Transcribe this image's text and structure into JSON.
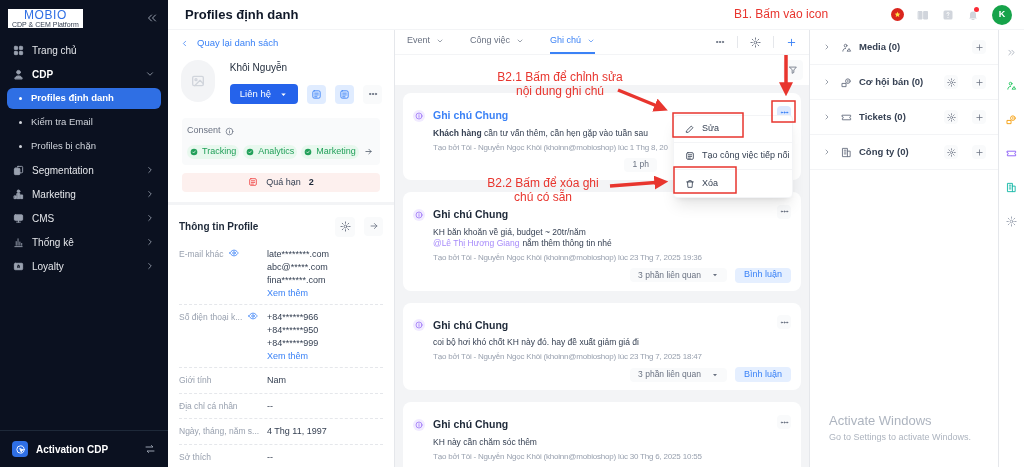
{
  "sidebar": {
    "logo": {
      "title": "MOBIO",
      "subtitle": "CDP & CEM Platform"
    },
    "items": [
      {
        "label": "Trang chủ",
        "kind": "home",
        "selected": false
      },
      {
        "label": "CDP",
        "kind": "person",
        "selected": false,
        "expanded": true,
        "children": [
          {
            "label": "Profiles định danh",
            "selected": true
          },
          {
            "label": "Kiểm tra Email",
            "selected": false
          },
          {
            "label": "Profiles bị chặn",
            "selected": false
          }
        ]
      },
      {
        "label": "Segmentation",
        "kind": "segment",
        "selected": false,
        "expanded": false
      },
      {
        "label": "Marketing",
        "kind": "marketing",
        "selected": false,
        "expanded": false
      },
      {
        "label": "CMS",
        "kind": "monitor",
        "selected": false,
        "expanded": false
      },
      {
        "label": "Thống kê",
        "kind": "chart",
        "selected": false,
        "expanded": false
      },
      {
        "label": "Loyalty",
        "kind": "loyalty",
        "selected": false,
        "expanded": false
      }
    ],
    "footer": {
      "label": "Activation CDP"
    }
  },
  "header": {
    "title": "Profiles định danh",
    "notification_dot": true,
    "avatar": "K"
  },
  "profile": {
    "back": "Quay lại danh sách",
    "name": "Khôi Nguyễn",
    "contact_button": "Liên hệ",
    "consent": {
      "label": "Consent",
      "chips": [
        "Tracking",
        "Analytics",
        "Marketing"
      ]
    },
    "overdue": {
      "label": "Quá hạn",
      "count": "2"
    },
    "info_title": "Thông tin Profile",
    "fields": [
      {
        "label": "E-mail khác",
        "reveal_icon": true,
        "values": [
          "late********.com",
          "abc@*****.com",
          "fina*******.com"
        ],
        "more": "Xem thêm"
      },
      {
        "label": "Số điện thoại k...",
        "reveal_icon": true,
        "values": [
          "+84******966",
          "+84******950",
          "+84******999"
        ],
        "more": "Xem thêm"
      },
      {
        "label": "Giới tính",
        "values": [
          "Nam"
        ]
      },
      {
        "label": "Địa chỉ cá nhân",
        "values": [
          "--"
        ]
      },
      {
        "label": "Ngày, tháng, năm s...",
        "values": [
          "4 Thg 11, 1997"
        ]
      },
      {
        "label": "Sở thích",
        "values": [
          "--"
        ]
      }
    ]
  },
  "notes_panel": {
    "tabs": [
      {
        "label": "Event",
        "selected": false
      },
      {
        "label": "Công việc",
        "selected": false
      },
      {
        "label": "Ghi chú",
        "selected": true
      }
    ],
    "notes": [
      {
        "title": "Ghi chú Chung",
        "highlighted": true,
        "menu_open": true,
        "lines": [
          {
            "text": "**Khách hàng** cần tư vấn thêm, cần hẹn gặp vào tuần sau"
          }
        ],
        "meta": "Tạo bởi Tôi - Nguyễn Ngọc Khôi (khoinn@mobioshop) lúc 1 Thg 8, 20",
        "related": "1 ph"
      },
      {
        "title": "Ghi chú Chung",
        "highlighted": false,
        "menu_open": false,
        "lines": [
          {
            "text": "KH băn khoăn về giá, budget ~ 20tr/năm"
          },
          {
            "mention": "@Lê Thị Hương Giang",
            "text": "nắm thêm thông tin nhé"
          }
        ],
        "meta": "Tạo bởi Tôi - Nguyễn Ngọc Khôi (khoinn@mobioshop) lúc 23 Thg 7, 2025 19:36",
        "related": "3 phần liên quan",
        "comment": "Bình luận"
      },
      {
        "title": "Ghi chú Chung",
        "highlighted": false,
        "menu_open": false,
        "lines": [
          {
            "text": "coi bộ hơi khó chốt KH này đó. hay đề xuất giảm giá đi"
          }
        ],
        "meta": "Tạo bởi Tôi - Nguyễn Ngọc Khôi (khoinn@mobioshop) lúc 23 Thg 7, 2025 18:47",
        "related": "3 phần liên quan",
        "comment": "Bình luận"
      },
      {
        "title": "Ghi chú Chung",
        "highlighted": false,
        "menu_open": false,
        "lines": [
          {
            "text": "KH này cần chăm sóc thêm"
          }
        ],
        "meta": "Tạo bởi Tôi - Nguyễn Ngọc Khôi (khoinn@mobioshop) lúc 30 Thg 6, 2025 10:55"
      }
    ],
    "menu": {
      "items": [
        {
          "label": "Sửa",
          "kind": "edit"
        },
        {
          "label": "Tạo công việc tiếp nối",
          "kind": "task"
        },
        {
          "label": "Xóa",
          "kind": "delete"
        }
      ]
    }
  },
  "right_panel": {
    "sections": [
      {
        "label": "Media (0)",
        "kind": "media",
        "expanded": false,
        "settings": false
      },
      {
        "label": "Cơ hội bán (0)",
        "kind": "deal",
        "expanded": false,
        "settings": true
      },
      {
        "label": "Tickets (0)",
        "kind": "ticket",
        "expanded": false,
        "settings": true
      },
      {
        "label": "Công ty (0)",
        "kind": "company",
        "expanded": false,
        "settings": true
      }
    ]
  },
  "annotations": [
    {
      "text": "B1. Bấm vào icon"
    },
    {
      "text": "B2.1 Bấm để chỉnh sửa nội dung ghi chú"
    },
    {
      "text": "B2.2 Bấm để xóa ghi chú có sẵn"
    }
  ],
  "os_notice": {
    "title": "Activate Windows",
    "text": "Go to Settings to activate Windows."
  }
}
